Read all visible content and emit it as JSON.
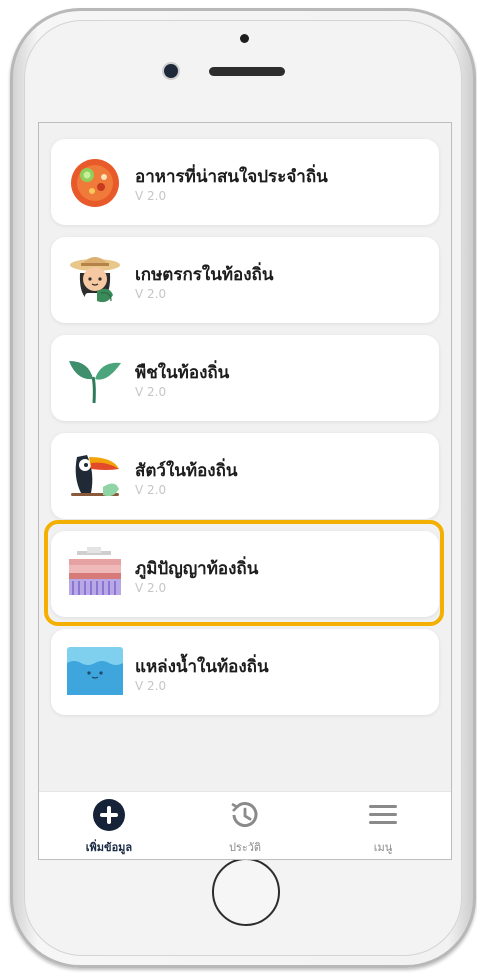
{
  "items": [
    {
      "title": "อาหารที่น่าสนใจประจำถิ่น",
      "version": "V 2.0",
      "icon": "food-icon"
    },
    {
      "title": "เกษตรกรในท้องถิ่น",
      "version": "V 2.0",
      "icon": "farmer-icon"
    },
    {
      "title": "พืชในท้องถิ่น",
      "version": "V 2.0",
      "icon": "plant-icon"
    },
    {
      "title": "สัตว์ในท้องถิ่น",
      "version": "V 2.0",
      "icon": "toucan-icon"
    },
    {
      "title": "ภูมิปัญญาท้องถิ่น",
      "version": "V 2.0",
      "icon": "loom-icon"
    },
    {
      "title": "แหล่งน้ำในท้องถิ่น",
      "version": "V 2.0",
      "icon": "water-icon"
    }
  ],
  "highlight_color": "#f4b000",
  "tabs": [
    {
      "label": "เพิ่มข้อมูล",
      "icon": "add-circle-icon",
      "active": true
    },
    {
      "label": "ประวัติ",
      "icon": "history-icon",
      "active": false
    },
    {
      "label": "เมนู",
      "icon": "menu-icon",
      "active": false
    }
  ]
}
